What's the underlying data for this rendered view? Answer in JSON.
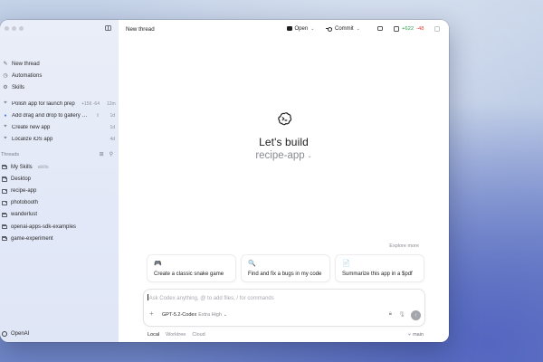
{
  "sidebar": {
    "nav": [
      {
        "icon": "new-thread-icon",
        "label": "New thread"
      },
      {
        "icon": "automations-icon",
        "label": "Automations"
      },
      {
        "icon": "skills-icon",
        "label": "Skills"
      }
    ],
    "tasks": [
      {
        "icon": "pin-icon",
        "label": "Polish app for launch prep",
        "meta_plus": "+156",
        "meta_minus": "-64",
        "time": "12m"
      },
      {
        "icon": "dot-icon",
        "label": "Add drag and drop to gallery phot...",
        "meta_extra": "⇧",
        "time": "1d"
      },
      {
        "icon": "pin-icon",
        "label": "Create new app",
        "time": "1d"
      },
      {
        "icon": "pin-icon",
        "label": "Localize iOS app",
        "time": "4d"
      }
    ],
    "threads_header": "Threads",
    "threads": [
      {
        "label": "My Skills",
        "sub": "skills"
      },
      {
        "label": "Desktop"
      },
      {
        "label": "recipe-app"
      },
      {
        "label": "photobooth"
      },
      {
        "label": "wanderlust"
      },
      {
        "label": "openai-apps-sdk-examples"
      },
      {
        "label": "game-experiment"
      }
    ],
    "account": "OpenAI"
  },
  "topbar": {
    "title": "New thread",
    "open_label": "Open",
    "commit_label": "Commit",
    "diff_plus": "+622",
    "diff_minus": "-48"
  },
  "hero": {
    "title": "Let's build",
    "project": "recipe-app"
  },
  "explore_more": "Explore more",
  "cards": [
    {
      "icon": "game-controller-icon",
      "glyph": "🎮",
      "text": "Create a classic snake game"
    },
    {
      "icon": "magnifier-icon",
      "glyph": "🔍",
      "text": "Find and fix a bugs in my code"
    },
    {
      "icon": "document-icon",
      "glyph": "📄",
      "text": "Summarize this app in a $pdf"
    }
  ],
  "composer": {
    "placeholder": "Ask Codex anything, @ to add files, / for commands",
    "model": "GPT-5.2-Codex",
    "effort": "Extra High"
  },
  "footer": {
    "modes": [
      "Local",
      "Worktree",
      "Cloud"
    ],
    "active_mode": "Local",
    "branch": "main"
  }
}
